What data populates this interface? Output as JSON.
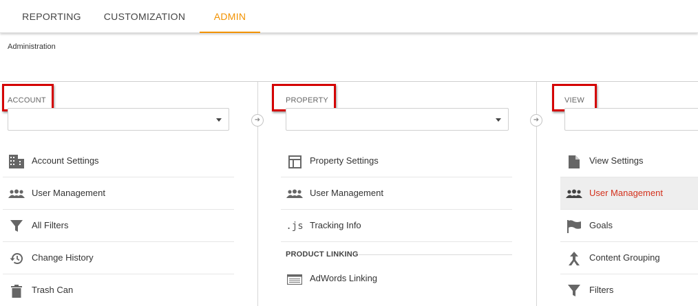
{
  "tabs": [
    {
      "label": "REPORTING"
    },
    {
      "label": "CUSTOMIZATION"
    },
    {
      "label": "ADMIN",
      "active": true
    }
  ],
  "breadcrumb": "Administration",
  "colors": {
    "accent": "#f29200",
    "highlight_red": "#d40000",
    "active_text": "#d3301b"
  },
  "account": {
    "header": "ACCOUNT",
    "select_value": "",
    "items": [
      {
        "label": "Account Settings",
        "icon": "building-icon"
      },
      {
        "label": "User Management",
        "icon": "users-icon"
      },
      {
        "label": "All Filters",
        "icon": "filter-icon"
      },
      {
        "label": "Change History",
        "icon": "history-icon"
      },
      {
        "label": "Trash Can",
        "icon": "trash-icon"
      }
    ]
  },
  "property": {
    "header": "PROPERTY",
    "select_value": "",
    "items": [
      {
        "label": "Property Settings",
        "icon": "property-icon"
      },
      {
        "label": "User Management",
        "icon": "users-icon"
      },
      {
        "label": "Tracking Info",
        "icon": "js-icon"
      }
    ],
    "section_label": "PRODUCT LINKING",
    "section_items": [
      {
        "label": "AdWords Linking",
        "icon": "adwords-icon"
      }
    ]
  },
  "view": {
    "header": "VIEW",
    "select_value": "",
    "items": [
      {
        "label": "View Settings",
        "icon": "document-icon"
      },
      {
        "label": "User Management",
        "icon": "users-icon",
        "active": true
      },
      {
        "label": "Goals",
        "icon": "flag-icon"
      },
      {
        "label": "Content Grouping",
        "icon": "grouping-icon"
      },
      {
        "label": "Filters",
        "icon": "filter-icon"
      }
    ]
  }
}
